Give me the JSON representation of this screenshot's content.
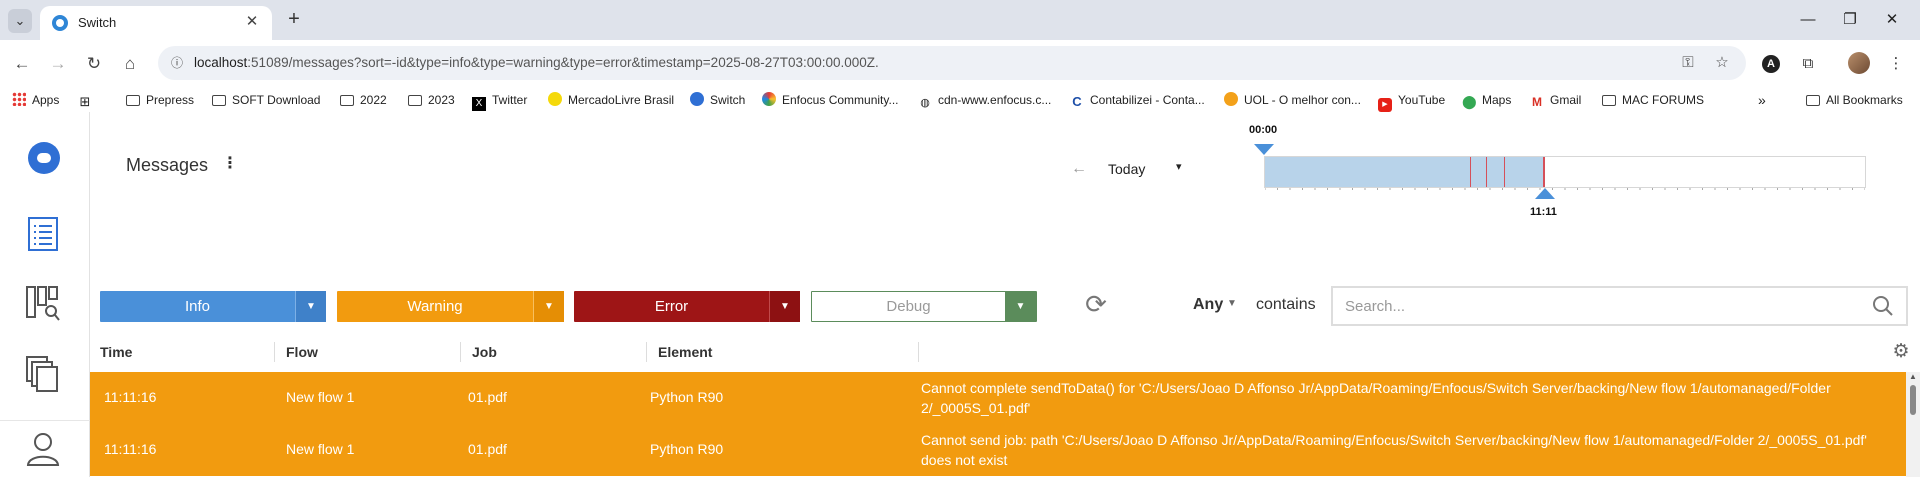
{
  "browser": {
    "tab_title": "Switch",
    "url_host": "localhost",
    "url_rest": ":51089/messages?sort=-id&type=info&type=warning&type=error&timestamp=2025-08-27T03:00:00.000Z."
  },
  "bookmarks": [
    {
      "label": "Apps",
      "icon": "apps-icon"
    },
    {
      "label": "Prepress",
      "icon": "folder-icon"
    },
    {
      "label": "SOFT Download",
      "icon": "folder-icon"
    },
    {
      "label": "2022",
      "icon": "folder-icon"
    },
    {
      "label": "2023",
      "icon": "folder-icon"
    },
    {
      "label": "Twitter",
      "icon": "x-logo-icon"
    },
    {
      "label": "MercadoLivre Brasil",
      "icon": "handshake-icon"
    },
    {
      "label": "Switch",
      "icon": "switch-icon"
    },
    {
      "label": "Enfocus Community...",
      "icon": "enfocus-icon"
    },
    {
      "label": "cdn-www.enfocus.c...",
      "icon": "globe-icon"
    },
    {
      "label": "Contabilizei - Conta...",
      "icon": "contabilizei-icon"
    },
    {
      "label": "UOL - O melhor con...",
      "icon": "uol-icon"
    },
    {
      "label": "YouTube",
      "icon": "youtube-icon"
    },
    {
      "label": "Maps",
      "icon": "maps-icon"
    },
    {
      "label": "Gmail",
      "icon": "gmail-icon"
    },
    {
      "label": "MAC FORUMS",
      "icon": "folder-icon"
    }
  ],
  "all_bookmarks": "All Bookmarks",
  "page": {
    "title": "Messages",
    "date_label": "Today",
    "timeline_start": "00:00",
    "timeline_end": "11:11",
    "timeline_fill_fraction": 0.465
  },
  "filters": {
    "info": "Info",
    "warning": "Warning",
    "error": "Error",
    "debug": "Debug"
  },
  "search": {
    "scope": "Any",
    "contains": "contains",
    "placeholder": "Search..."
  },
  "table": {
    "columns": [
      "Time",
      "Flow",
      "Job",
      "Element"
    ],
    "rows": [
      {
        "time": "11:11:16",
        "flow": "New flow 1",
        "job": "01.pdf",
        "element": "Python R90",
        "message": "Cannot complete sendToData() for 'C:/Users/Joao D Affonso Jr/AppData/Roaming/Enfocus/Switch Server/backing/New flow 1/automanaged/Folder 2/_0005S_01.pdf'"
      },
      {
        "time": "11:11:16",
        "flow": "New flow 1",
        "job": "01.pdf",
        "element": "Python R90",
        "message": "Cannot send job: path 'C:/Users/Joao D Affonso Jr/AppData/Roaming/Enfocus/Switch Server/backing/New flow 1/automanaged/Folder 2/_0005S_01.pdf' does not exist"
      }
    ]
  },
  "colors": {
    "info": "#4a90d9",
    "warning": "#f29b0f",
    "error": "#9e1516",
    "debug": "#5b8c5b"
  }
}
